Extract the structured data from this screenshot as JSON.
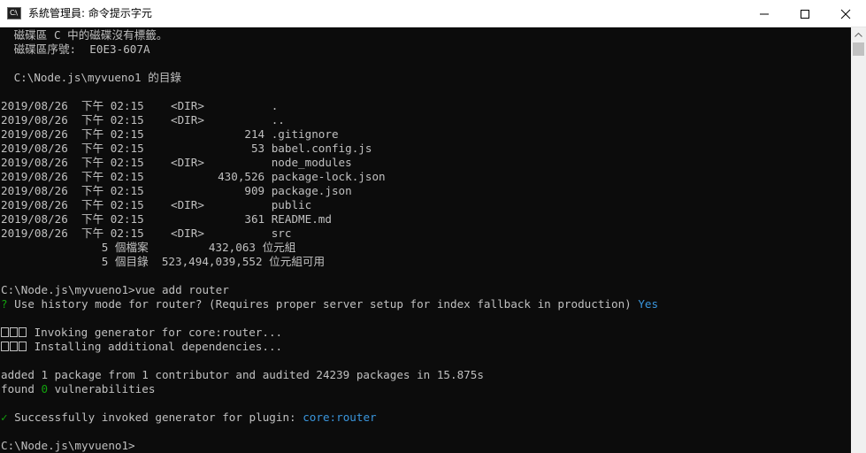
{
  "window": {
    "title": "系統管理員: 命令提示字元",
    "icon_label": "C:\\"
  },
  "console": {
    "lines": [
      " 磁碟區 C 中的磁碟沒有標籤。",
      " 磁碟區序號:  E0E3-607A",
      "",
      " C:\\Node.js\\myvueno1 的目錄",
      "",
      "2019/08/26  下午 02:15    <DIR>          .",
      "2019/08/26  下午 02:15    <DIR>          ..",
      "2019/08/26  下午 02:15               214 .gitignore",
      "2019/08/26  下午 02:15                53 babel.config.js",
      "2019/08/26  下午 02:15    <DIR>          node_modules",
      "2019/08/26  下午 02:15           430,526 package-lock.json",
      "2019/08/26  下午 02:15               909 package.json",
      "2019/08/26  下午 02:15    <DIR>          public",
      "2019/08/26  下午 02:15               361 README.md",
      "2019/08/26  下午 02:15    <DIR>          src",
      "               5 個檔案         432,063 位元組",
      "               5 個目錄  523,494,039,552 位元組可用",
      "",
      "C:\\Node.js\\myvueno1>vue add router",
      "",
      "",
      " Invoking generator for core:router...",
      " Installing additional dependencies...",
      "",
      "added 1 package from 1 contributor and audited 24239 packages in 15.875s",
      "found ",
      "",
      " Successfully invoked generator for plugin: ",
      "",
      "C:\\Node.js\\myvueno1>"
    ],
    "prompt_question": {
      "mark": "?",
      "text": " Use history mode for router? (Requires proper server setup for index fallback in production) ",
      "answer": "Yes"
    },
    "vulnerabilities": {
      "count": "0",
      "suffix": " vulnerabilities"
    },
    "success": {
      "mark": "✓",
      "plugin": "core:router"
    }
  },
  "colors": {
    "background": "#0c0c0c",
    "text": "#c0c0c0",
    "cyan": "#3a96dd",
    "green": "#13a10e"
  }
}
